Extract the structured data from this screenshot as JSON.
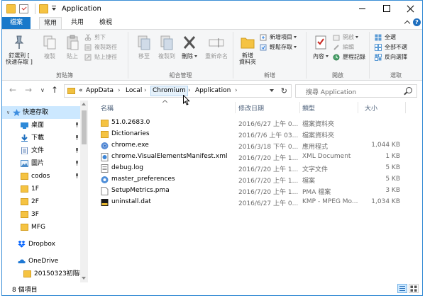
{
  "window": {
    "title": "Application"
  },
  "ribbon_tabs": [
    {
      "label": "檔案"
    },
    {
      "label": "常用"
    },
    {
      "label": "共用"
    },
    {
      "label": "檢視"
    }
  ],
  "ribbon": {
    "clipboard": {
      "group_label": "剪貼簿",
      "pin": "釘選到 [ 快速存取 ]",
      "copy": "複製",
      "paste": "貼上",
      "cut": "剪下",
      "copy_path": "複製路徑",
      "paste_shortcut": "貼上捷徑"
    },
    "organize": {
      "group_label": "組合管理",
      "move_to": "移至",
      "copy_to": "複製到",
      "delete": "刪除",
      "rename": "重新命名"
    },
    "new": {
      "group_label": "新增",
      "new_folder": "新增\n資料夾",
      "new_item": "新增項目",
      "easy_access": "輕鬆存取"
    },
    "open": {
      "group_label": "開啟",
      "properties": "內容",
      "open": "開啟",
      "edit": "編輯",
      "history": "歷程記錄"
    },
    "select": {
      "group_label": "選取",
      "select_all": "全選",
      "select_none": "全部不選",
      "invert": "反向選擇"
    }
  },
  "address": {
    "overflow": "«",
    "crumbs": [
      "AppData",
      "Local",
      "Chromium",
      "Application"
    ],
    "search_placeholder": "搜尋 Application"
  },
  "nav_pane": {
    "items": [
      {
        "label": "快速存取",
        "icon": "star-icon",
        "pinned": false
      },
      {
        "label": "桌面",
        "icon": "desktop-icon",
        "pinned": true
      },
      {
        "label": "下載",
        "icon": "download-icon",
        "pinned": true
      },
      {
        "label": "文件",
        "icon": "documents-icon",
        "pinned": true
      },
      {
        "label": "圖片",
        "icon": "pictures-icon",
        "pinned": true
      },
      {
        "label": "codos",
        "icon": "folder-icon",
        "pinned": true
      },
      {
        "label": "1F",
        "icon": "folder-icon",
        "pinned": false
      },
      {
        "label": "2F",
        "icon": "folder-icon",
        "pinned": false
      },
      {
        "label": "3F",
        "icon": "folder-icon",
        "pinned": false
      },
      {
        "label": "MFG",
        "icon": "folder-icon",
        "pinned": false
      },
      {
        "label": "Dropbox",
        "icon": "dropbox-icon",
        "pinned": false
      },
      {
        "label": "OneDrive",
        "icon": "onedrive-icon",
        "pinned": false
      },
      {
        "label": "20150323初階稽",
        "icon": "folder-icon",
        "pinned": false
      }
    ]
  },
  "columns": {
    "name": "名稱",
    "date": "修改日期",
    "type": "類型",
    "size": "大小"
  },
  "files": [
    {
      "name": "51.0.2683.0",
      "date": "2016/6/27 上午 0...",
      "type": "檔案資料夾",
      "size": "",
      "icon": "folder-icon"
    },
    {
      "name": "Dictionaries",
      "date": "2016/7/6 上午 03...",
      "type": "檔案資料夾",
      "size": "",
      "icon": "folder-icon"
    },
    {
      "name": "chrome.exe",
      "date": "2016/3/18 下午 0...",
      "type": "應用程式",
      "size": "1,044 KB",
      "icon": "chromium-icon"
    },
    {
      "name": "chrome.VisualElementsManifest.xml",
      "date": "2016/7/20 上午 1...",
      "type": "XML Document",
      "size": "1 KB",
      "icon": "xml-file-icon"
    },
    {
      "name": "debug.log",
      "date": "2016/7/20 上午 1...",
      "type": "文字文件",
      "size": "5 KB",
      "icon": "text-file-icon"
    },
    {
      "name": "master_preferences",
      "date": "2016/7/20 上午 1...",
      "type": "檔案",
      "size": "5 KB",
      "icon": "preferences-file-icon"
    },
    {
      "name": "SetupMetrics.pma",
      "date": "2016/7/20 上午 1...",
      "type": "PMA 檔案",
      "size": "3 KB",
      "icon": "file-icon"
    },
    {
      "name": "uninstall.dat",
      "date": "2016/6/27 上午 0...",
      "type": "KMP - MPEG Mo...",
      "size": "1,034 KB",
      "icon": "kmp-file-icon"
    }
  ],
  "status": {
    "item_count": "8 個項目"
  },
  "colors": {
    "accent": "#1979ca",
    "selection": "#cce8ff",
    "folder": "#f5c342"
  }
}
